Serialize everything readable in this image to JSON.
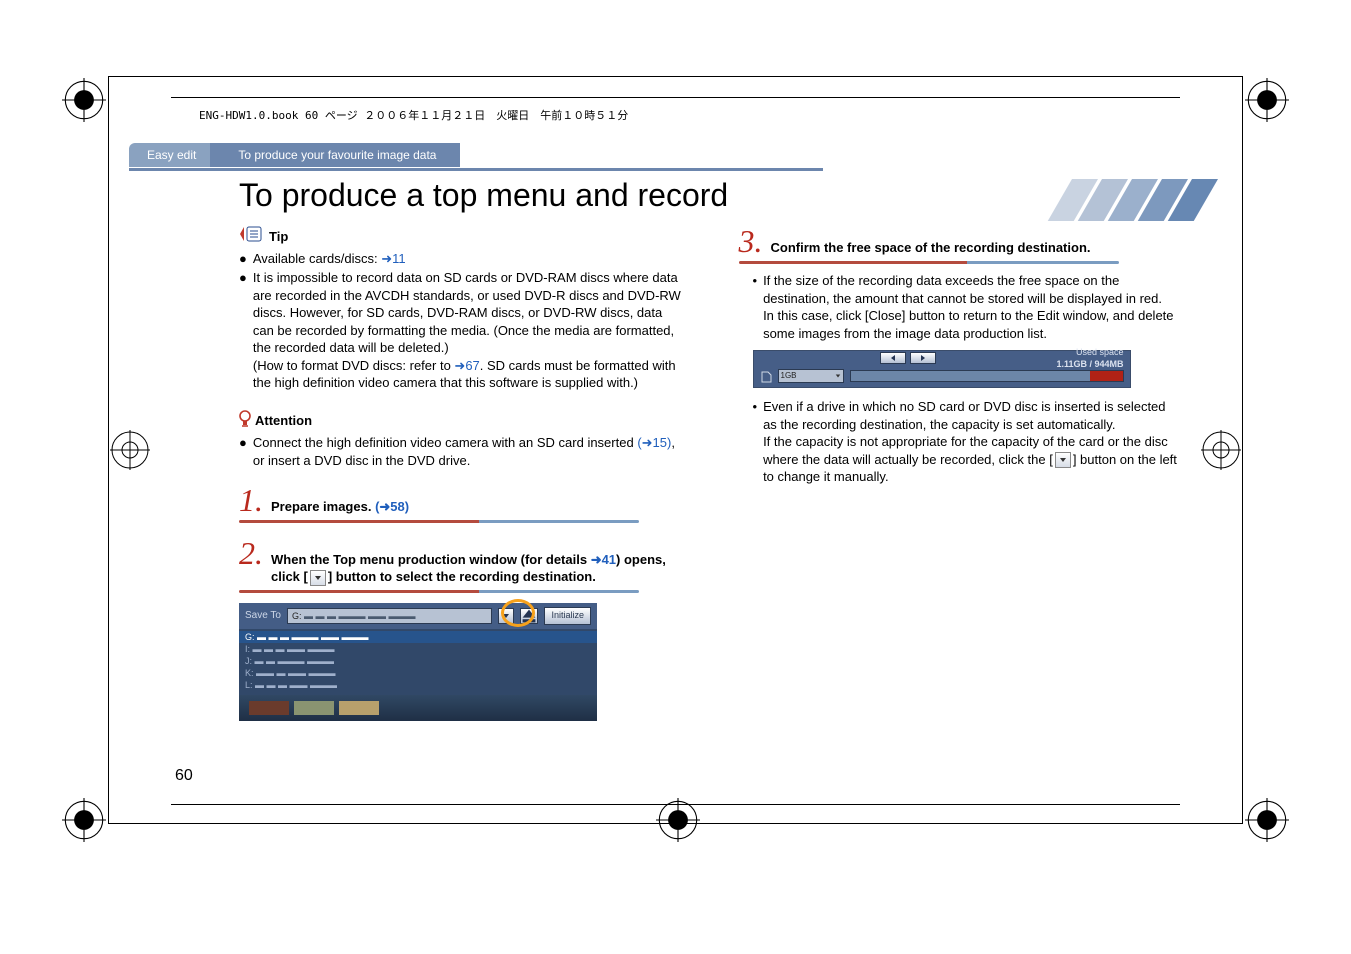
{
  "header_meta": "ENG-HDW1.0.book  60 ページ  ２００６年１１月２１日　火曜日　午前１０時５１分",
  "tab1": "Easy edit",
  "tab2": "To produce your favourite image data",
  "title": "To produce a top menu and record",
  "tip_label": "Tip",
  "tip_bullet1_a": "Available cards/discs: ",
  "tip_bullet1_link": "➜11",
  "tip_bullet2_a": "It is impossible to record data on SD cards or DVD-RAM discs where data are recorded in the AVCDH standards, or used DVD-R discs and DVD-RW discs. However, for SD cards, DVD-RAM discs, or DVD-RW discs, data can be recorded by formatting the media. (Once the media are formatted, the recorded data will be deleted.)",
  "tip_bullet2_b": "(How to format DVD discs: refer to ",
  "tip_bullet2_link": "➜67",
  "tip_bullet2_c": ". SD cards must be formatted with the high definition video camera that this software is supplied with.)",
  "attention_label": "Attention",
  "attention_text_a": "Connect the high definition video camera with an SD card inserted ",
  "attention_link": "(➜15)",
  "attention_text_b": ", or insert a DVD disc in the DVD drive.",
  "step1_text_a": "Prepare images. ",
  "step1_link": "(➜58)",
  "step2_text_a": "When the Top menu production window (for details ",
  "step2_link": "➜41",
  "step2_text_b": ") opens, click [",
  "step2_text_c": "] button to select the recording destination.",
  "save_to_label": "Save To",
  "save_drive": "G:",
  "initialize_label": "Initialize",
  "drive_list_sel": "G:",
  "drive_list": [
    "I:",
    "J:",
    "K:",
    "L:"
  ],
  "step3_text": "Confirm the free space of the recording destination.",
  "col2_p1": "If the size of the recording data exceeds the free space on the destination, the amount that cannot be stored will be displayed in red.",
  "col2_p1b": "In this case, click [Close] button to return to the Edit window, and delete some images from the image data production list.",
  "used_space_label": "Used space",
  "used_space_value": "1.11GB / 944MB",
  "capacity_value": "1GB",
  "col2_p2a": "Even if a drive in which no SD card or DVD disc is inserted is selected as the recording destination, the capacity is set automatically.",
  "col2_p2b_a": "If the capacity is not appropriate for the capacity of the card or the disc where the data will actually be recorded, click the [",
  "col2_p2b_b": "] button on the left to change it manually.",
  "page_number": "60",
  "step_numbers": {
    "s1": "1.",
    "s2": "2.",
    "s3": "3."
  }
}
